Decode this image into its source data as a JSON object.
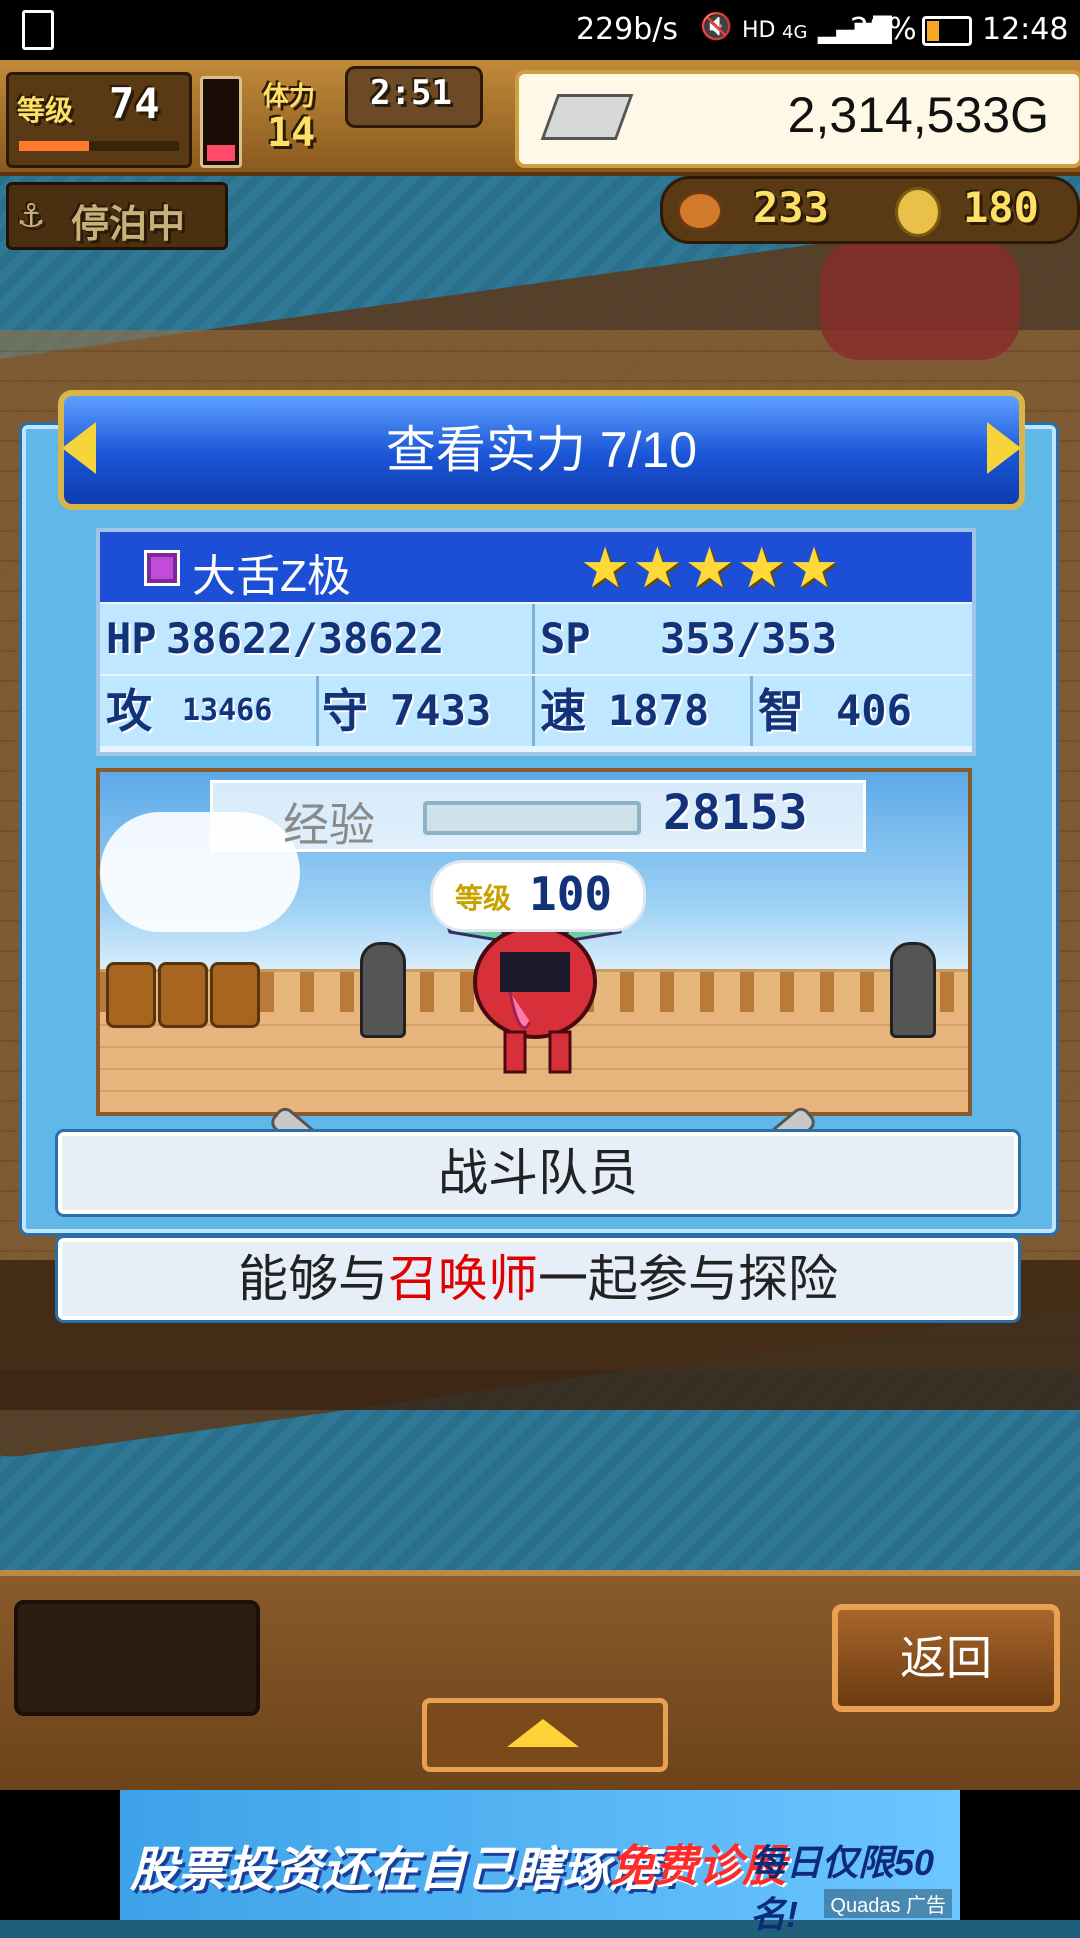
{
  "status_bar": {
    "speed": "229b/s",
    "network": "4G",
    "battery": "28%",
    "time": "12:48"
  },
  "hud": {
    "level_label": "等级",
    "level_value": "74",
    "stamina_label": "体力",
    "stamina_value": "14",
    "timer": "2:51",
    "gold": "2,314,533G",
    "status": "停泊中",
    "resource1": "233",
    "resource2": "180"
  },
  "dialog": {
    "title": "查看实力 7/10",
    "unit": {
      "name": "大舌Z极",
      "stars": "★★★★★",
      "star_count": 5,
      "hp_label": "HP",
      "hp": "38622/38622",
      "sp_label": "SP",
      "sp": "353/353",
      "atk_label": "攻",
      "atk": "13466",
      "def_label": "守",
      "def": "7433",
      "spd_label": "速",
      "spd": "1878",
      "int_label": "智",
      "int": "406"
    },
    "exp_label": "经验",
    "exp_value": "28153",
    "level_badge_label": "等级",
    "level_badge_value": "100",
    "role": "战斗队员",
    "description": {
      "prefix": "能够与",
      "highlight": "召唤师",
      "suffix": "一起参与探险"
    }
  },
  "bottom": {
    "return_label": "返回"
  },
  "ad": {
    "text1": "股票投资还在自己瞎琢磨?",
    "text2": "免费诊股",
    "text3": "每日仅限50名!",
    "tag": "Quadas 广告"
  },
  "colors": {
    "header_blue": "#1a55d6",
    "gold_border": "#d9b54a",
    "dialog_bg": "#5fb8e8",
    "highlight_red": "#e00000"
  }
}
